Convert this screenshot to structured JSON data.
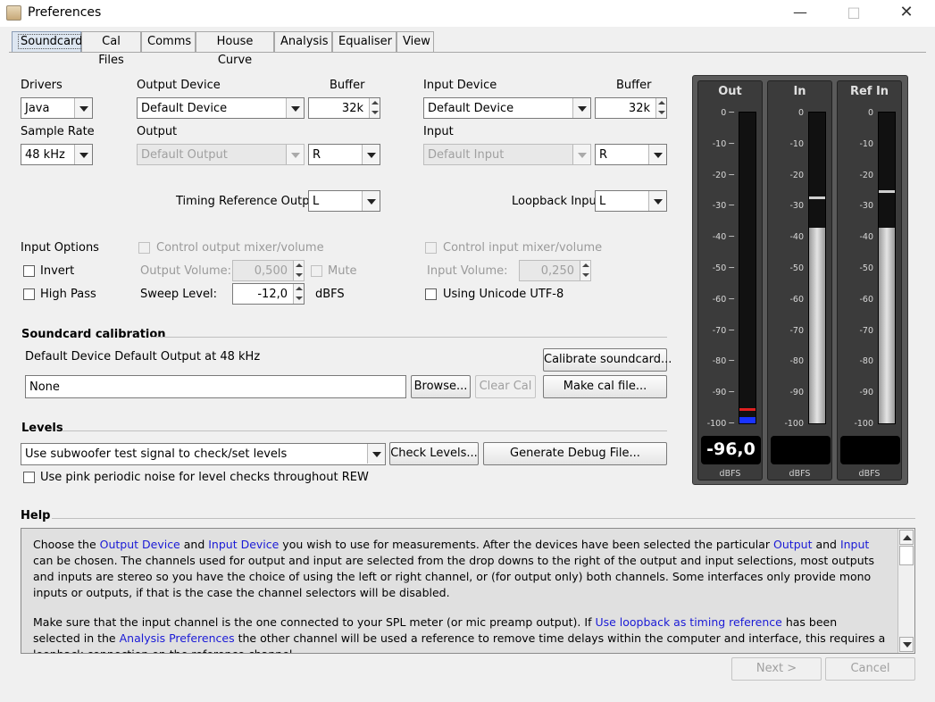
{
  "window": {
    "title": "Preferences"
  },
  "tabs": [
    "Soundcard",
    "Cal Files",
    "Comms",
    "House Curve",
    "Analysis",
    "Equaliser",
    "View"
  ],
  "soundcard": {
    "drivers_label": "Drivers",
    "drivers_value": "Java",
    "sample_rate_label": "Sample Rate",
    "sample_rate_value": "48 kHz",
    "output_device_label": "Output Device",
    "output_device_value": "Default Device",
    "output_buffer_label": "Buffer",
    "output_buffer_value": "32k",
    "output_label": "Output",
    "output_value": "Default Output",
    "output_channel": "R",
    "input_device_label": "Input Device",
    "input_device_value": "Default Device",
    "input_buffer_label": "Buffer",
    "input_buffer_value": "32k",
    "input_label": "Input",
    "input_value": "Default Input",
    "input_channel": "R",
    "timing_ref_label": "Timing Reference Output",
    "timing_ref_value": "L",
    "loopback_label": "Loopback Input",
    "loopback_value": "L"
  },
  "input_options": {
    "heading": "Input Options",
    "invert": "Invert",
    "high_pass": "High Pass",
    "control_output": "Control output mixer/volume",
    "output_volume_label": "Output Volume:",
    "output_volume_value": "0,500",
    "mute": "Mute",
    "sweep_level_label": "Sweep Level:",
    "sweep_level_value": "-12,0",
    "sweep_level_unit": "dBFS",
    "control_input": "Control input mixer/volume",
    "input_volume_label": "Input Volume:",
    "input_volume_value": "0,250",
    "unicode": "Using Unicode UTF-8"
  },
  "calibration": {
    "heading": "Soundcard calibration",
    "status": "Default Device Default Output at 48 kHz",
    "calibrate_button": "Calibrate soundcard...",
    "file_value": "None",
    "browse_button": "Browse...",
    "clear_button": "Clear Cal",
    "make_button": "Make cal file..."
  },
  "levels": {
    "heading": "Levels",
    "signal_value": "Use subwoofer test signal to check/set levels",
    "check_button": "Check Levels...",
    "debug_button": "Generate Debug File...",
    "pink_noise": "Use pink periodic noise for level checks throughout REW"
  },
  "meters": {
    "ticks": [
      "0",
      "-10",
      "-20",
      "-30",
      "-40",
      "-50",
      "-60",
      "-70",
      "-80",
      "-90",
      "-100"
    ],
    "items": [
      {
        "title": "Out",
        "readout": "-96,0",
        "unit": "dBFS",
        "level_fraction": 0.02,
        "peak_fraction": 0.04,
        "color": "#1a33ff"
      },
      {
        "title": "In",
        "readout": "",
        "unit": "dBFS",
        "level_fraction": 0.63,
        "peak_fraction": 0.72,
        "color": "#d8d8d8"
      },
      {
        "title": "Ref In",
        "readout": "",
        "unit": "dBFS",
        "level_fraction": 0.63,
        "peak_fraction": 0.74,
        "color": "#d8d8d8"
      }
    ]
  },
  "help": {
    "heading": "Help",
    "p1": [
      {
        "t": "Choose the "
      },
      {
        "t": "Output Device",
        "link": true
      },
      {
        "t": " and "
      },
      {
        "t": "Input Device",
        "link": true
      },
      {
        "t": " you wish to use for measurements. After the devices have been selected the particular "
      },
      {
        "t": "Output",
        "link": true
      },
      {
        "t": " and "
      },
      {
        "t": "Input",
        "link": true
      },
      {
        "t": " can be chosen. The channels used for output and input are selected from the drop downs to the right of the output and input selections, most outputs and inputs are stereo so you have the choice of using the left or right channel, or (for output only) both channels. Some interfaces only provide mono inputs or outputs, if that is the case the channel selectors will be disabled."
      }
    ],
    "p2": [
      {
        "t": "Make sure that the input channel is the one connected to your SPL meter (or mic preamp output). If "
      },
      {
        "t": "Use loopback as timing reference",
        "link": true
      },
      {
        "t": " has been selected in the "
      },
      {
        "t": "Analysis Preferences",
        "link": true
      },
      {
        "t": " the other channel will be used a reference to remove time delays within the computer and interface, this requires a loopback connection on the reference channel."
      }
    ]
  },
  "footer": {
    "next_button": "Next >",
    "cancel_button": "Cancel"
  }
}
